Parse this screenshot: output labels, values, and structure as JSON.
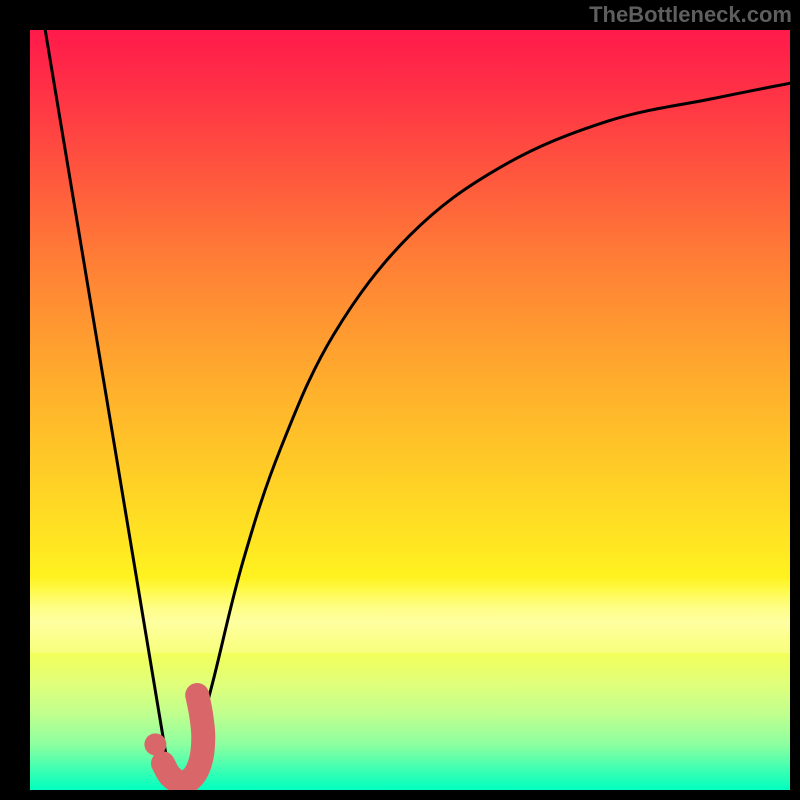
{
  "watermark": "TheBottleneck.com",
  "chart_data": {
    "type": "line",
    "title": "",
    "xlabel": "",
    "ylabel": "",
    "xlim": [
      0,
      100
    ],
    "ylim": [
      0,
      100
    ],
    "grid": false,
    "series": [
      {
        "name": "left-descent",
        "color": "#000000",
        "x": [
          2,
          18
        ],
        "values": [
          100,
          4
        ]
      },
      {
        "name": "right-curve",
        "color": "#000000",
        "x": [
          21,
          24,
          28,
          33,
          40,
          50,
          62,
          76,
          90,
          100
        ],
        "values": [
          3,
          14,
          30,
          45,
          60,
          73,
          82,
          88,
          91,
          93
        ]
      },
      {
        "name": "j-stroke",
        "color": "#d9676a",
        "x": [
          17.5,
          18.5,
          20.0,
          21.5,
          22.5,
          22.8,
          22.5,
          22.0
        ],
        "values": [
          3.5,
          1.8,
          1.0,
          1.8,
          4.0,
          7.0,
          10.0,
          12.5
        ]
      },
      {
        "name": "dot",
        "color": "#d9676a",
        "x": [
          16.5
        ],
        "values": [
          6.0
        ]
      }
    ],
    "annotations": []
  },
  "colors": {
    "background": "#000000",
    "curve": "#000000",
    "accent": "#d9676a",
    "watermark": "#5e5e5e"
  }
}
